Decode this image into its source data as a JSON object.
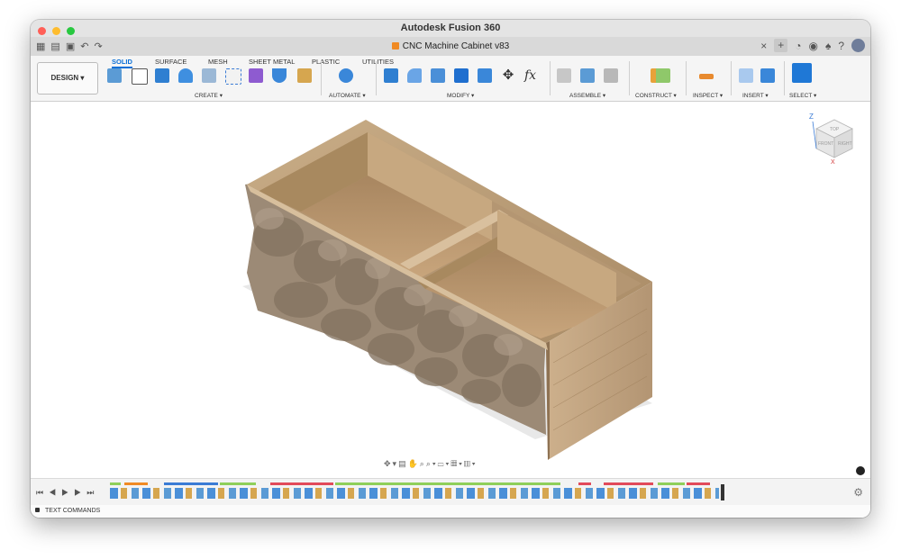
{
  "window": {
    "title": "Autodesk Fusion 360"
  },
  "document_tab": {
    "label": "CNC Machine Cabinet v83"
  },
  "ribbon": {
    "tabs": [
      "SOLID",
      "SURFACE",
      "MESH",
      "SHEET METAL",
      "PLASTIC",
      "UTILITIES"
    ],
    "active_tab": "SOLID",
    "workspace_button": "DESIGN ▾",
    "groups": [
      "CREATE ▾",
      "AUTOMATE ▾",
      "MODIFY ▾",
      "ASSEMBLE ▾",
      "CONSTRUCT ▾",
      "INSPECT ▾",
      "INSERT ▾",
      "SELECT ▾"
    ]
  },
  "viewcube": {
    "faces": [
      "TOP",
      "FRONT",
      "RIGHT"
    ],
    "axes": [
      "Z",
      "X"
    ]
  },
  "statusbar": {
    "text_commands": "TEXT COMMANDS"
  },
  "colors": {
    "accent": "#0a6fd6",
    "wood": "#b89c7a"
  }
}
